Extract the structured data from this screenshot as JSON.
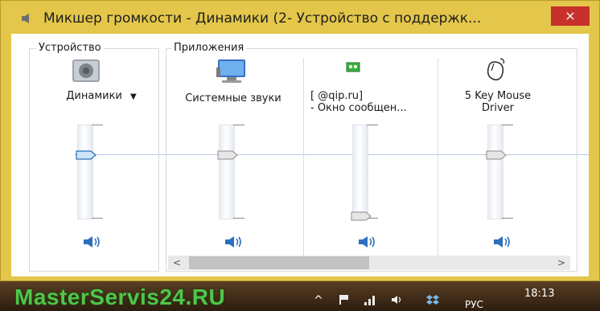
{
  "window": {
    "title": "Микшер громкости - Динамики (2- Устройство с поддержк...",
    "close_label": "×"
  },
  "device_group": {
    "label": "Устройство",
    "device": {
      "name": "Динамики",
      "dropdown_arrow": "▼",
      "volume": 0.6
    }
  },
  "apps_group": {
    "label": "Приложения",
    "apps": [
      {
        "name": "Системные звуки",
        "volume": 0.6
      },
      {
        "name_line1": "[                @qip.ru]",
        "name_line2": "- Окно сообщен...",
        "volume": 0.0
      },
      {
        "name_line1": "5 Key Mouse",
        "name_line2": "Driver",
        "volume": 0.6
      }
    ]
  },
  "scrollbar": {
    "left_arrow": "<",
    "right_arrow": ">"
  },
  "taskbar": {
    "watermark": "MasterServis24.RU",
    "overflow": "^",
    "language": "РУС",
    "time": "18:13",
    "date": ""
  },
  "icons": {
    "title": "speaker-icon",
    "device": "speaker-device-icon",
    "system_sounds": "monitor-icon",
    "qip": "qip-icon",
    "mouse": "mouse-icon",
    "mute": "speaker-mute-toggle-icon"
  },
  "colors": {
    "frame": "#e3c64a",
    "close": "#c7302c",
    "accent": "#2c6fbd",
    "watermark": "#4ec64a"
  }
}
